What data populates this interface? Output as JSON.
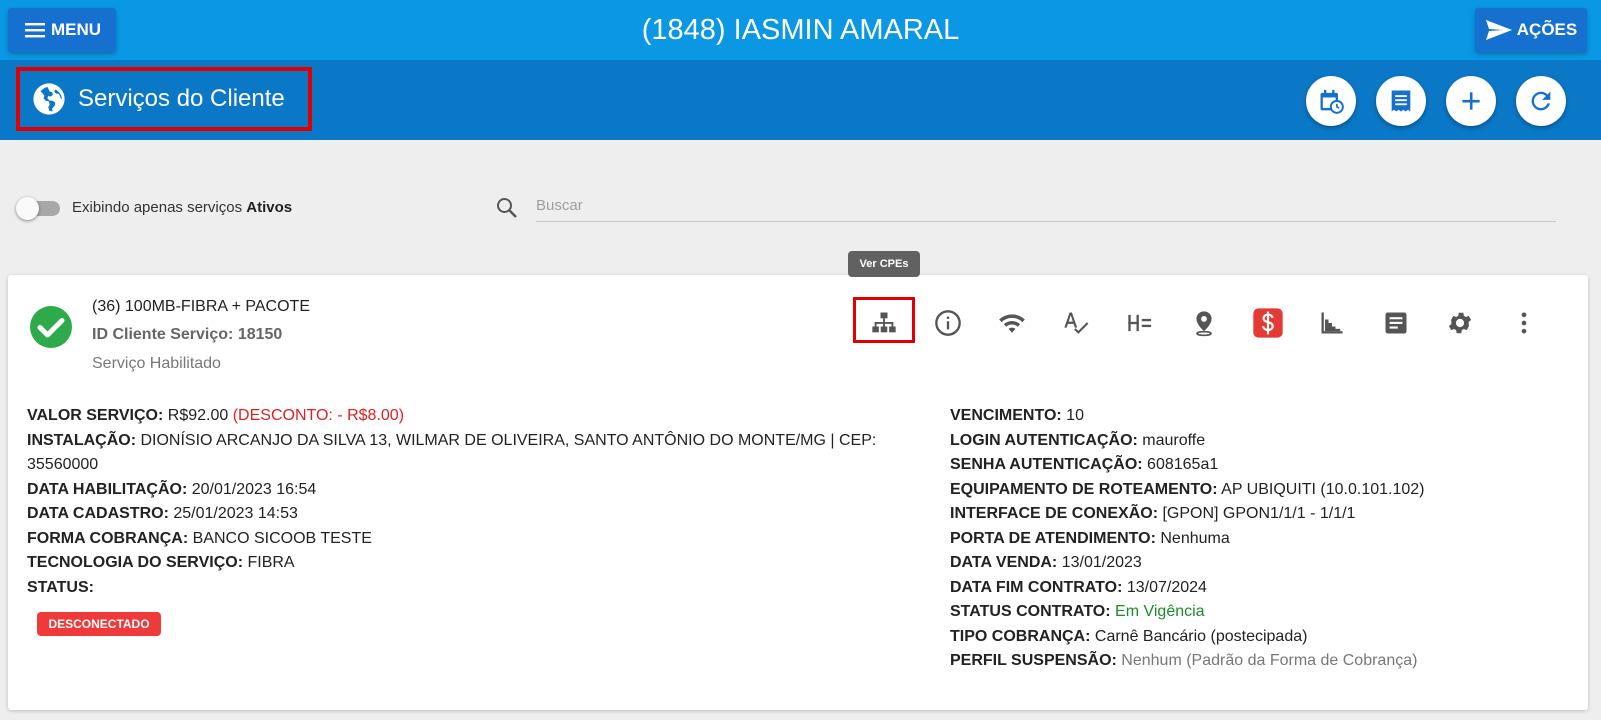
{
  "topbar": {
    "menu_label": "MENU",
    "title": "(1848) IASMIN AMARAL",
    "acoes_label": "AÇÕES"
  },
  "section": {
    "title": "Serviços do Cliente",
    "icon": "globe-icon",
    "buttons": [
      "calendar-clock-icon",
      "list-document-icon",
      "plus-icon",
      "refresh-icon"
    ]
  },
  "filter": {
    "toggle_label_prefix": "Exibindo apenas serviços",
    "toggle_label_bold": "Ativos",
    "search_placeholder": "Buscar"
  },
  "tooltip": "Ver CPEs",
  "service": {
    "name": "(36) 100MB-FIBRA + PACOTE",
    "id_line": "ID Cliente Serviço: 18150",
    "status": "Serviço Habilitado",
    "actions": [
      "network-tree-icon",
      "info-icon",
      "wifi-icon",
      "spellcheck-icon",
      "h-equals-icon",
      "map-pin-icon",
      "dollar-icon",
      "stairs-chart-icon",
      "notes-icon",
      "gear-icon",
      "more-vert-icon"
    ],
    "left": {
      "valor_label": "VALOR SERVIÇO:",
      "valor_value": "R$92.00",
      "valor_discount": "(DESCONTO: - R$8.00)",
      "instalacao_label": "INSTALAÇÃO:",
      "instalacao_value": "DIONÍSIO ARCANJO DA SILVA 13, WILMAR DE OLIVEIRA, SANTO ANTÔNIO DO MONTE/MG | CEP: 35560000",
      "habilitacao_label": "DATA HABILITAÇÃO:",
      "habilitacao_value": "20/01/2023 16:54",
      "cadastro_label": "DATA CADASTRO:",
      "cadastro_value": "25/01/2023 14:53",
      "cobranca_label": "FORMA COBRANÇA:",
      "cobranca_value": "BANCO SICOOB TESTE",
      "tecnologia_label": "TECNOLOGIA DO SERVIÇO:",
      "tecnologia_value": "FIBRA",
      "status_label": "STATUS:",
      "status_badge": "DESCONECTADO"
    },
    "right": {
      "vencimento_label": "VENCIMENTO:",
      "vencimento_value": "10",
      "login_label": "LOGIN AUTENTICAÇÃO:",
      "login_value": "mauroffe",
      "senha_label": "SENHA AUTENTICAÇÃO:",
      "senha_value": "608165a1",
      "equip_label": "EQUIPAMENTO DE ROTEAMENTO:",
      "equip_value": "AP UBIQUITI (10.0.101.102)",
      "interface_label": "INTERFACE DE CONEXÃO:",
      "interface_value": "[GPON] GPON1/1/1 - 1/1/1",
      "porta_label": "PORTA DE ATENDIMENTO:",
      "porta_value": "Nenhuma",
      "venda_label": "DATA VENDA:",
      "venda_value": "13/01/2023",
      "fim_label": "DATA FIM CONTRATO:",
      "fim_value": "13/07/2024",
      "status_contrato_label": "STATUS CONTRATO:",
      "status_contrato_value": "Em Vigência",
      "tipo_label": "TIPO COBRANÇA:",
      "tipo_value": "Carnê Bancário (postecipada)",
      "perfil_label": "PERFIL SUSPENSÃO:",
      "perfil_value": "Nenhum (Padrão da Forma de Cobrança)"
    }
  },
  "colors": {
    "topbar": "#0a97e4",
    "section_bar": "#0b77c7",
    "button": "#1570cf",
    "highlight_red": "#e00000",
    "success_green": "#2eaa4a",
    "danger": "#f03a3a"
  }
}
